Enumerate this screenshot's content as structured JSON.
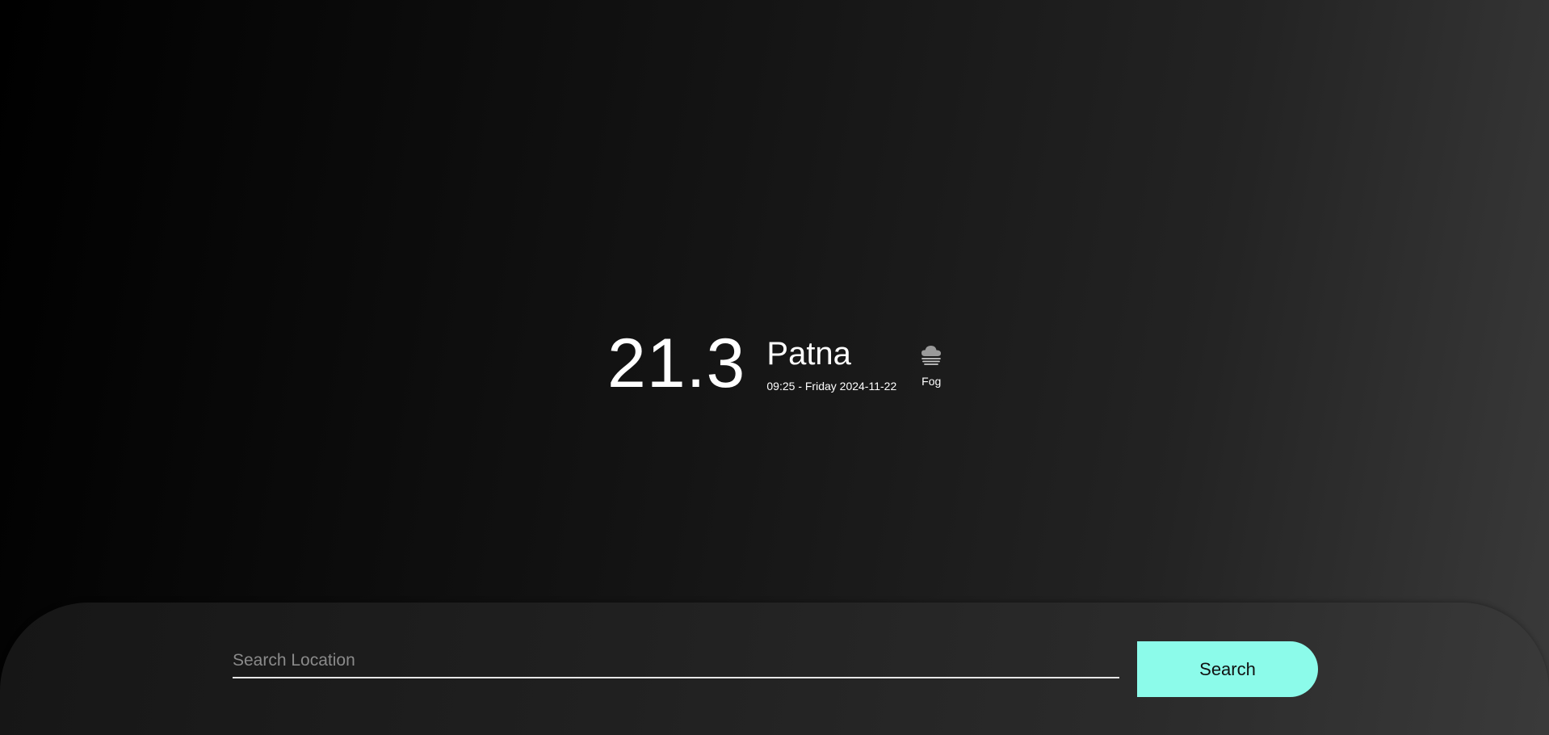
{
  "weather": {
    "temperature": "21.3",
    "city": "Patna",
    "datetime": "09:25 - Friday 2024-11-22",
    "condition": "Fog",
    "condition_icon": "fog-icon"
  },
  "search": {
    "placeholder": "Search Location",
    "value": "",
    "button_label": "Search"
  },
  "colors": {
    "accent": "#8cfbea",
    "text": "#ffffff",
    "background_dark": "#000000"
  }
}
